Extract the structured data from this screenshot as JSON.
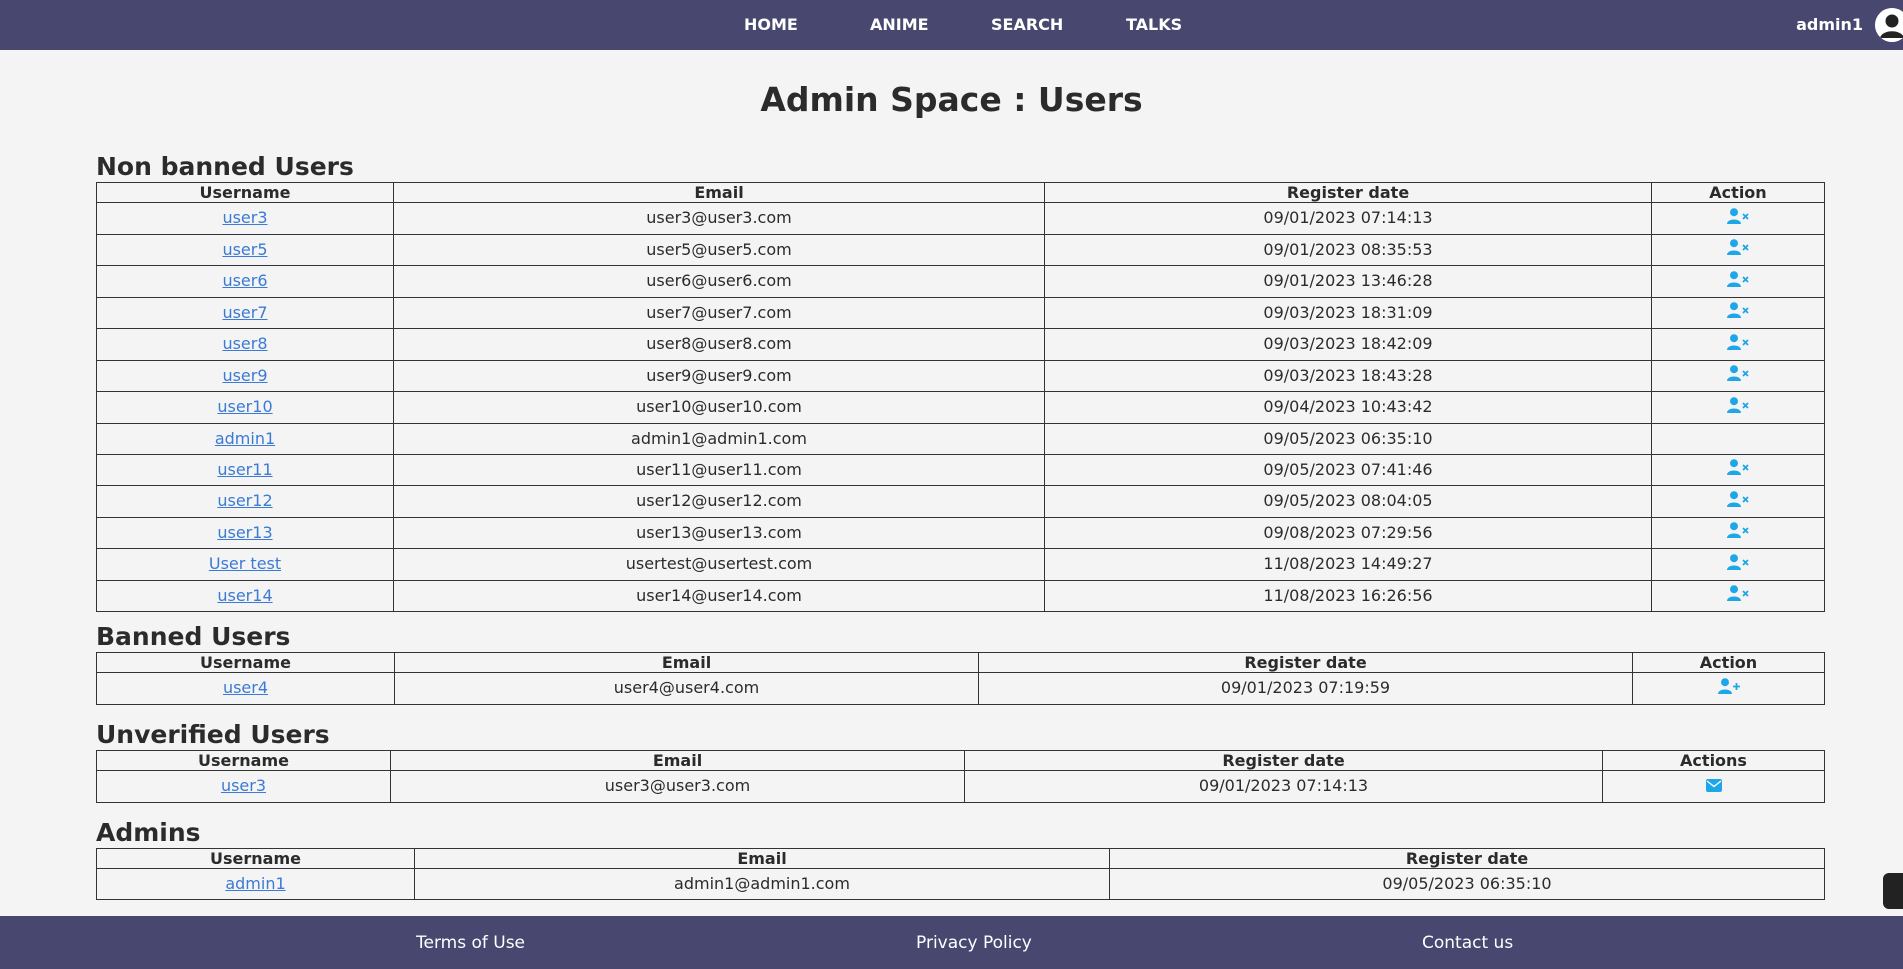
{
  "nav": {
    "items": [
      "HOME",
      "ANIME",
      "SEARCH",
      "TALKS"
    ],
    "user": "admin1"
  },
  "title": "Admin Space : Users",
  "colors": {
    "header_bg": "#474770",
    "icon_blue": "#1ea7e8",
    "link": "#3b7ad6"
  },
  "non_banned": {
    "title": "Non banned Users",
    "headers": [
      "Username",
      "Email",
      "Register date",
      "Action"
    ],
    "rows": [
      {
        "username": "user3",
        "email": "user3@user3.com",
        "date": "09/01/2023 07:14:13",
        "action": "ban-user-icon"
      },
      {
        "username": "user5",
        "email": "user5@user5.com",
        "date": "09/01/2023 08:35:53",
        "action": "ban-user-icon"
      },
      {
        "username": "user6",
        "email": "user6@user6.com",
        "date": "09/01/2023 13:46:28",
        "action": "ban-user-icon"
      },
      {
        "username": "user7",
        "email": "user7@user7.com",
        "date": "09/03/2023 18:31:09",
        "action": "ban-user-icon"
      },
      {
        "username": "user8",
        "email": "user8@user8.com",
        "date": "09/03/2023 18:42:09",
        "action": "ban-user-icon"
      },
      {
        "username": "user9",
        "email": "user9@user9.com",
        "date": "09/03/2023 18:43:28",
        "action": "ban-user-icon"
      },
      {
        "username": "user10",
        "email": "user10@user10.com",
        "date": "09/04/2023 10:43:42",
        "action": "ban-user-icon"
      },
      {
        "username": "admin1",
        "email": "admin1@admin1.com",
        "date": "09/05/2023 06:35:10",
        "action": ""
      },
      {
        "username": "user11",
        "email": "user11@user11.com",
        "date": "09/05/2023 07:41:46",
        "action": "ban-user-icon"
      },
      {
        "username": "user12",
        "email": "user12@user12.com",
        "date": "09/05/2023 08:04:05",
        "action": "ban-user-icon"
      },
      {
        "username": "user13",
        "email": "user13@user13.com",
        "date": "09/08/2023 07:29:56",
        "action": "ban-user-icon"
      },
      {
        "username": "User test",
        "email": "usertest@usertest.com",
        "date": "11/08/2023 14:49:27",
        "action": "ban-user-icon"
      },
      {
        "username": "user14",
        "email": "user14@user14.com",
        "date": "11/08/2023 16:26:56",
        "action": "ban-user-icon"
      }
    ]
  },
  "banned": {
    "title": "Banned Users",
    "headers": [
      "Username",
      "Email",
      "Register date",
      "Action"
    ],
    "rows": [
      {
        "username": "user4",
        "email": "user4@user4.com",
        "date": "09/01/2023 07:19:59",
        "action": "unban-user-icon"
      }
    ]
  },
  "unverified": {
    "title": "Unverified Users",
    "headers": [
      "Username",
      "Email",
      "Register date",
      "Actions"
    ],
    "rows": [
      {
        "username": "user3",
        "email": "user3@user3.com",
        "date": "09/01/2023 07:14:13",
        "action": "resend-email-icon"
      }
    ]
  },
  "admins": {
    "title": "Admins",
    "headers": [
      "Username",
      "Email",
      "Register date"
    ],
    "rows": [
      {
        "username": "admin1",
        "email": "admin1@admin1.com",
        "date": "09/05/2023 06:35:10"
      }
    ]
  },
  "footer": {
    "links": [
      "Terms of Use",
      "Privacy Policy",
      "Contact us"
    ]
  }
}
